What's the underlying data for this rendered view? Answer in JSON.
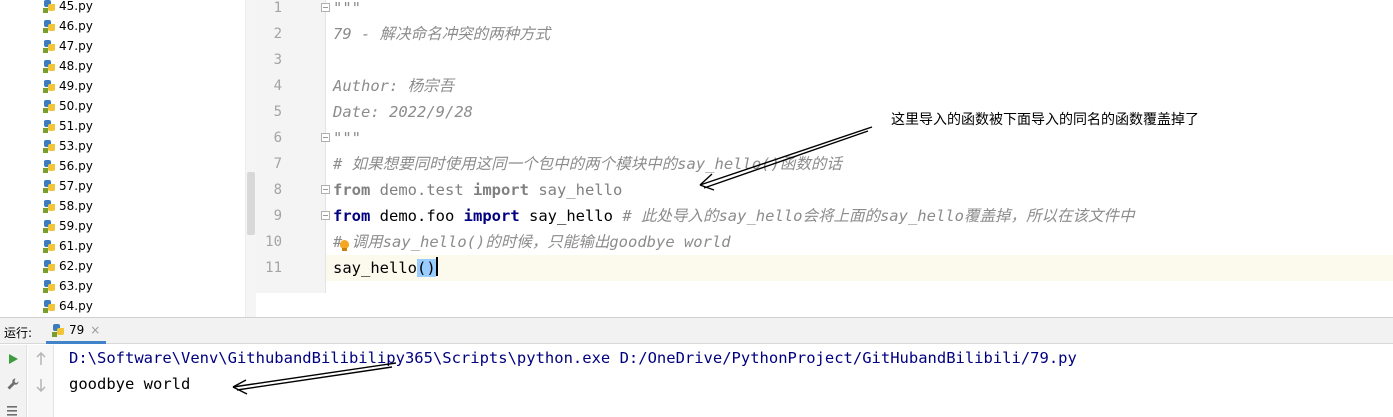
{
  "project_tree": {
    "files": [
      "45.py",
      "46.py",
      "47.py",
      "48.py",
      "49.py",
      "50.py",
      "51.py",
      "53.py",
      "56.py",
      "57.py",
      "58.py",
      "59.py",
      "61.py",
      "62.py",
      "63.py",
      "64.py"
    ]
  },
  "editor": {
    "line_numbers": [
      "1",
      "2",
      "3",
      "4",
      "5",
      "6",
      "7",
      "8",
      "9",
      "10",
      "11"
    ],
    "lines": {
      "l1": "\"\"\"",
      "l2": "79 - 解决命名冲突的两种方式",
      "l4": "Author: 杨宗吾",
      "l5": "Date: 2022/9/28",
      "l6": "\"\"\"",
      "l7": "# 如果想要同时使用这同一个包中的两个模块中的say_hello()函数的话",
      "l8_from": "from",
      "l8_module": " demo.test ",
      "l8_import": "import",
      "l8_name": " say_hello",
      "l9_from": "from",
      "l9_module": " demo.foo ",
      "l9_import": "import",
      "l9_name": " say_hello ",
      "l9_comment": "# 此处导入的say_hello会将上面的say_hello覆盖掉，所以在该文件中",
      "l10_hash": "#",
      "l10_comment": " 调用say_hello()的时候，只能输出goodbye world",
      "l11_call": "say_hello",
      "l11_parens": "()"
    }
  },
  "annotations": {
    "editor_note": "这里导入的函数被下面导入的同名的函数覆盖掉了"
  },
  "run_panel": {
    "label": "运行:",
    "tab_label": "79",
    "tab_close": "×",
    "command_line": "D:\\Software\\Venv\\GithubandBilibilipy365\\Scripts\\python.exe D:/OneDrive/PythonProject/GitHubandBilibili/79.py",
    "output_line": "goodbye world"
  },
  "colors": {
    "keyword": "#000080",
    "docstring": "#8c8c8c",
    "current_line_bg": "#fcfaed",
    "paren_highlight": "#99ccff",
    "run_icon": "#3d9c3d",
    "tab_underline": "#4083c9"
  }
}
